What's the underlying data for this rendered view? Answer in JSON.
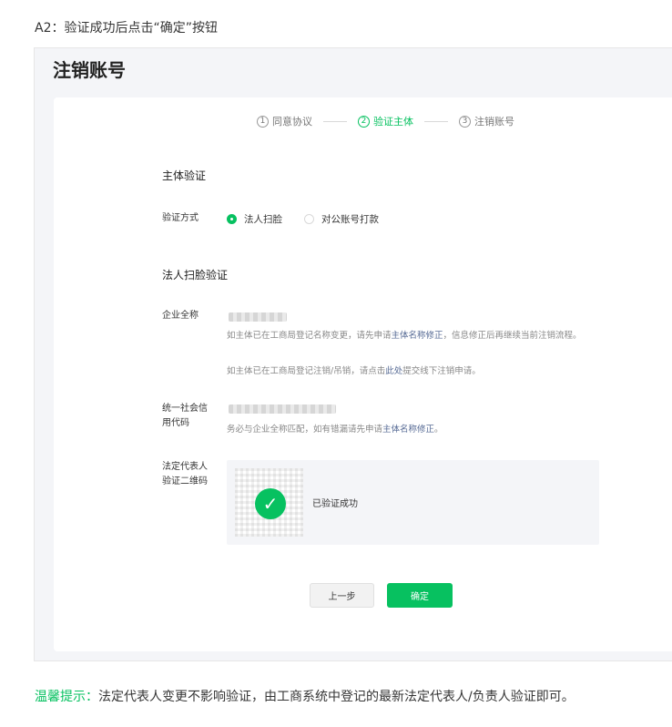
{
  "intro": "A2：验证成功后点击“确定”按钮",
  "page_title": "注销账号",
  "steps": [
    {
      "num": "1",
      "label": "同意协议",
      "active": false
    },
    {
      "num": "2",
      "label": "验证主体",
      "active": true
    },
    {
      "num": "3",
      "label": "注销账号",
      "active": false
    }
  ],
  "section_subject": "主体验证",
  "method": {
    "label": "验证方式",
    "options": [
      {
        "label": "法人扫脸",
        "checked": true
      },
      {
        "label": "对公账号打款",
        "checked": false
      }
    ]
  },
  "section_face": "法人扫脸验证",
  "company": {
    "label": "企业全称",
    "hint1_a": "如主体已在工商局登记名称变更，请先申请",
    "hint1_link": "主体名称修正",
    "hint1_b": "，信息修正后再继续当前注销流程。",
    "hint2_a": "如主体已在工商局登记注销/吊销，请点击",
    "hint2_link": "此处",
    "hint2_b": "提交线下注销申请。"
  },
  "credit": {
    "label_line1": "统一社会信",
    "label_line2": "用代码",
    "hint_a": "务必与企业全称匹配，如有错漏请先申请",
    "hint_link": "主体名称修正",
    "hint_b": "。"
  },
  "legal_qr": {
    "label_line1": "法定代表人",
    "label_line2": "验证二维码",
    "status": "已验证成功"
  },
  "buttons": {
    "prev": "上一步",
    "ok": "确定"
  },
  "tip": {
    "label": "温馨提示：",
    "text": "法定代表人变更不影响验证，由工商系统中登记的最新法定代表人/负责人验证即可。"
  },
  "colors": {
    "accent": "#07c160",
    "link": "#576b95"
  }
}
